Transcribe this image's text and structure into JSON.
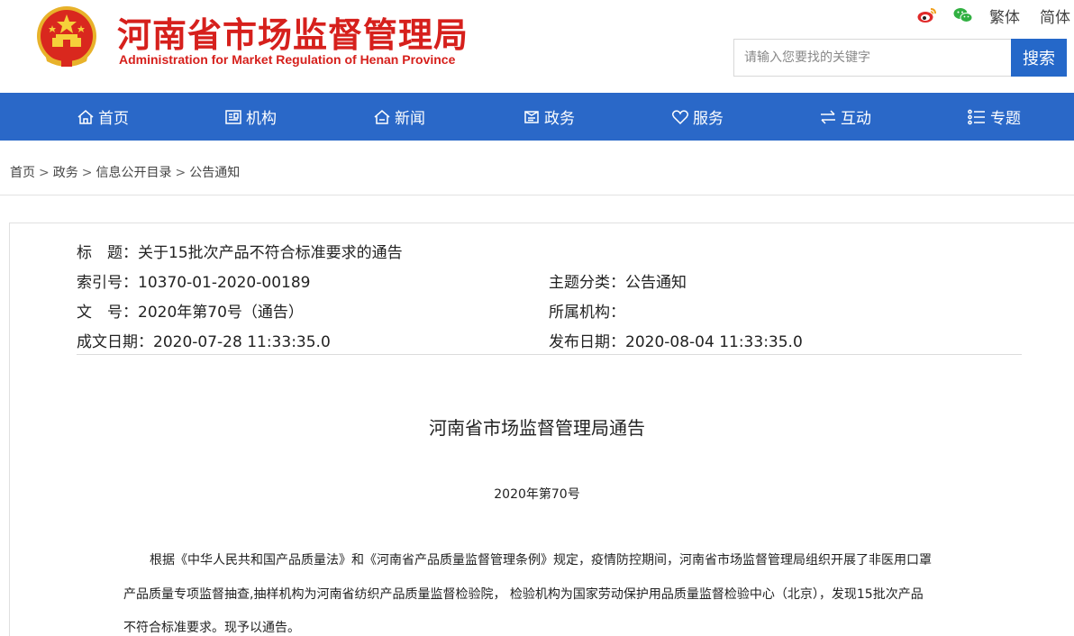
{
  "header": {
    "title_cn": "河南省市场监督管理局",
    "title_en": "Administration for Market Regulation of Henan Province",
    "weibo_icon": "weibo-icon",
    "wechat_icon": "wechat-icon",
    "traditional_label": "繁体",
    "simplified_label": "简体",
    "search_placeholder": "请输入您要找的关键字",
    "search_value": "",
    "search_button": "搜索"
  },
  "nav": {
    "items": [
      {
        "label": "首页",
        "icon": "home-icon"
      },
      {
        "label": "机构",
        "icon": "building-icon"
      },
      {
        "label": "新闻",
        "icon": "house-icon"
      },
      {
        "label": "政务",
        "icon": "document-icon"
      },
      {
        "label": "服务",
        "icon": "heart-icon"
      },
      {
        "label": "互动",
        "icon": "exchange-icon"
      },
      {
        "label": "专题",
        "icon": "list-icon"
      }
    ]
  },
  "breadcrumb": {
    "items": [
      "首页",
      "政务",
      "信息公开目录",
      "公告通知"
    ],
    "separator": ">"
  },
  "meta": {
    "title": "标　题：关于15批次产品不符合标准要求的通告",
    "index_no": "索引号：10370-01-2020-00189",
    "category": "主题分类：公告通知",
    "doc_no": "文　号：2020年第70号（通告）",
    "agency": "所属机构：",
    "created_date": "成文日期：2020-07-28 11:33:35.0",
    "published_date": "发布日期：2020-08-04 11:33:35.0"
  },
  "document": {
    "heading": "河南省市场监督管理局通告",
    "number": "2020年第70号",
    "paragraph_lines": [
      "根据《中华人民共和国产品质量法》和《河南省产品质量监督管理条例》规定，疫情防控期间，河南省市场监督管理局组织开展了非医用口罩",
      "产品质量专项监督抽查,抽样机构为河南省纺织产品质量监督检验院， 检验机构为国家劳动保护用品质量监督检验中心（北京），发现15批次产品",
      "不符合标准要求。现予以通告。"
    ]
  },
  "colors": {
    "brand_red": "#d6201c",
    "nav_blue": "#2a68c8",
    "button_blue": "#2568c9"
  }
}
